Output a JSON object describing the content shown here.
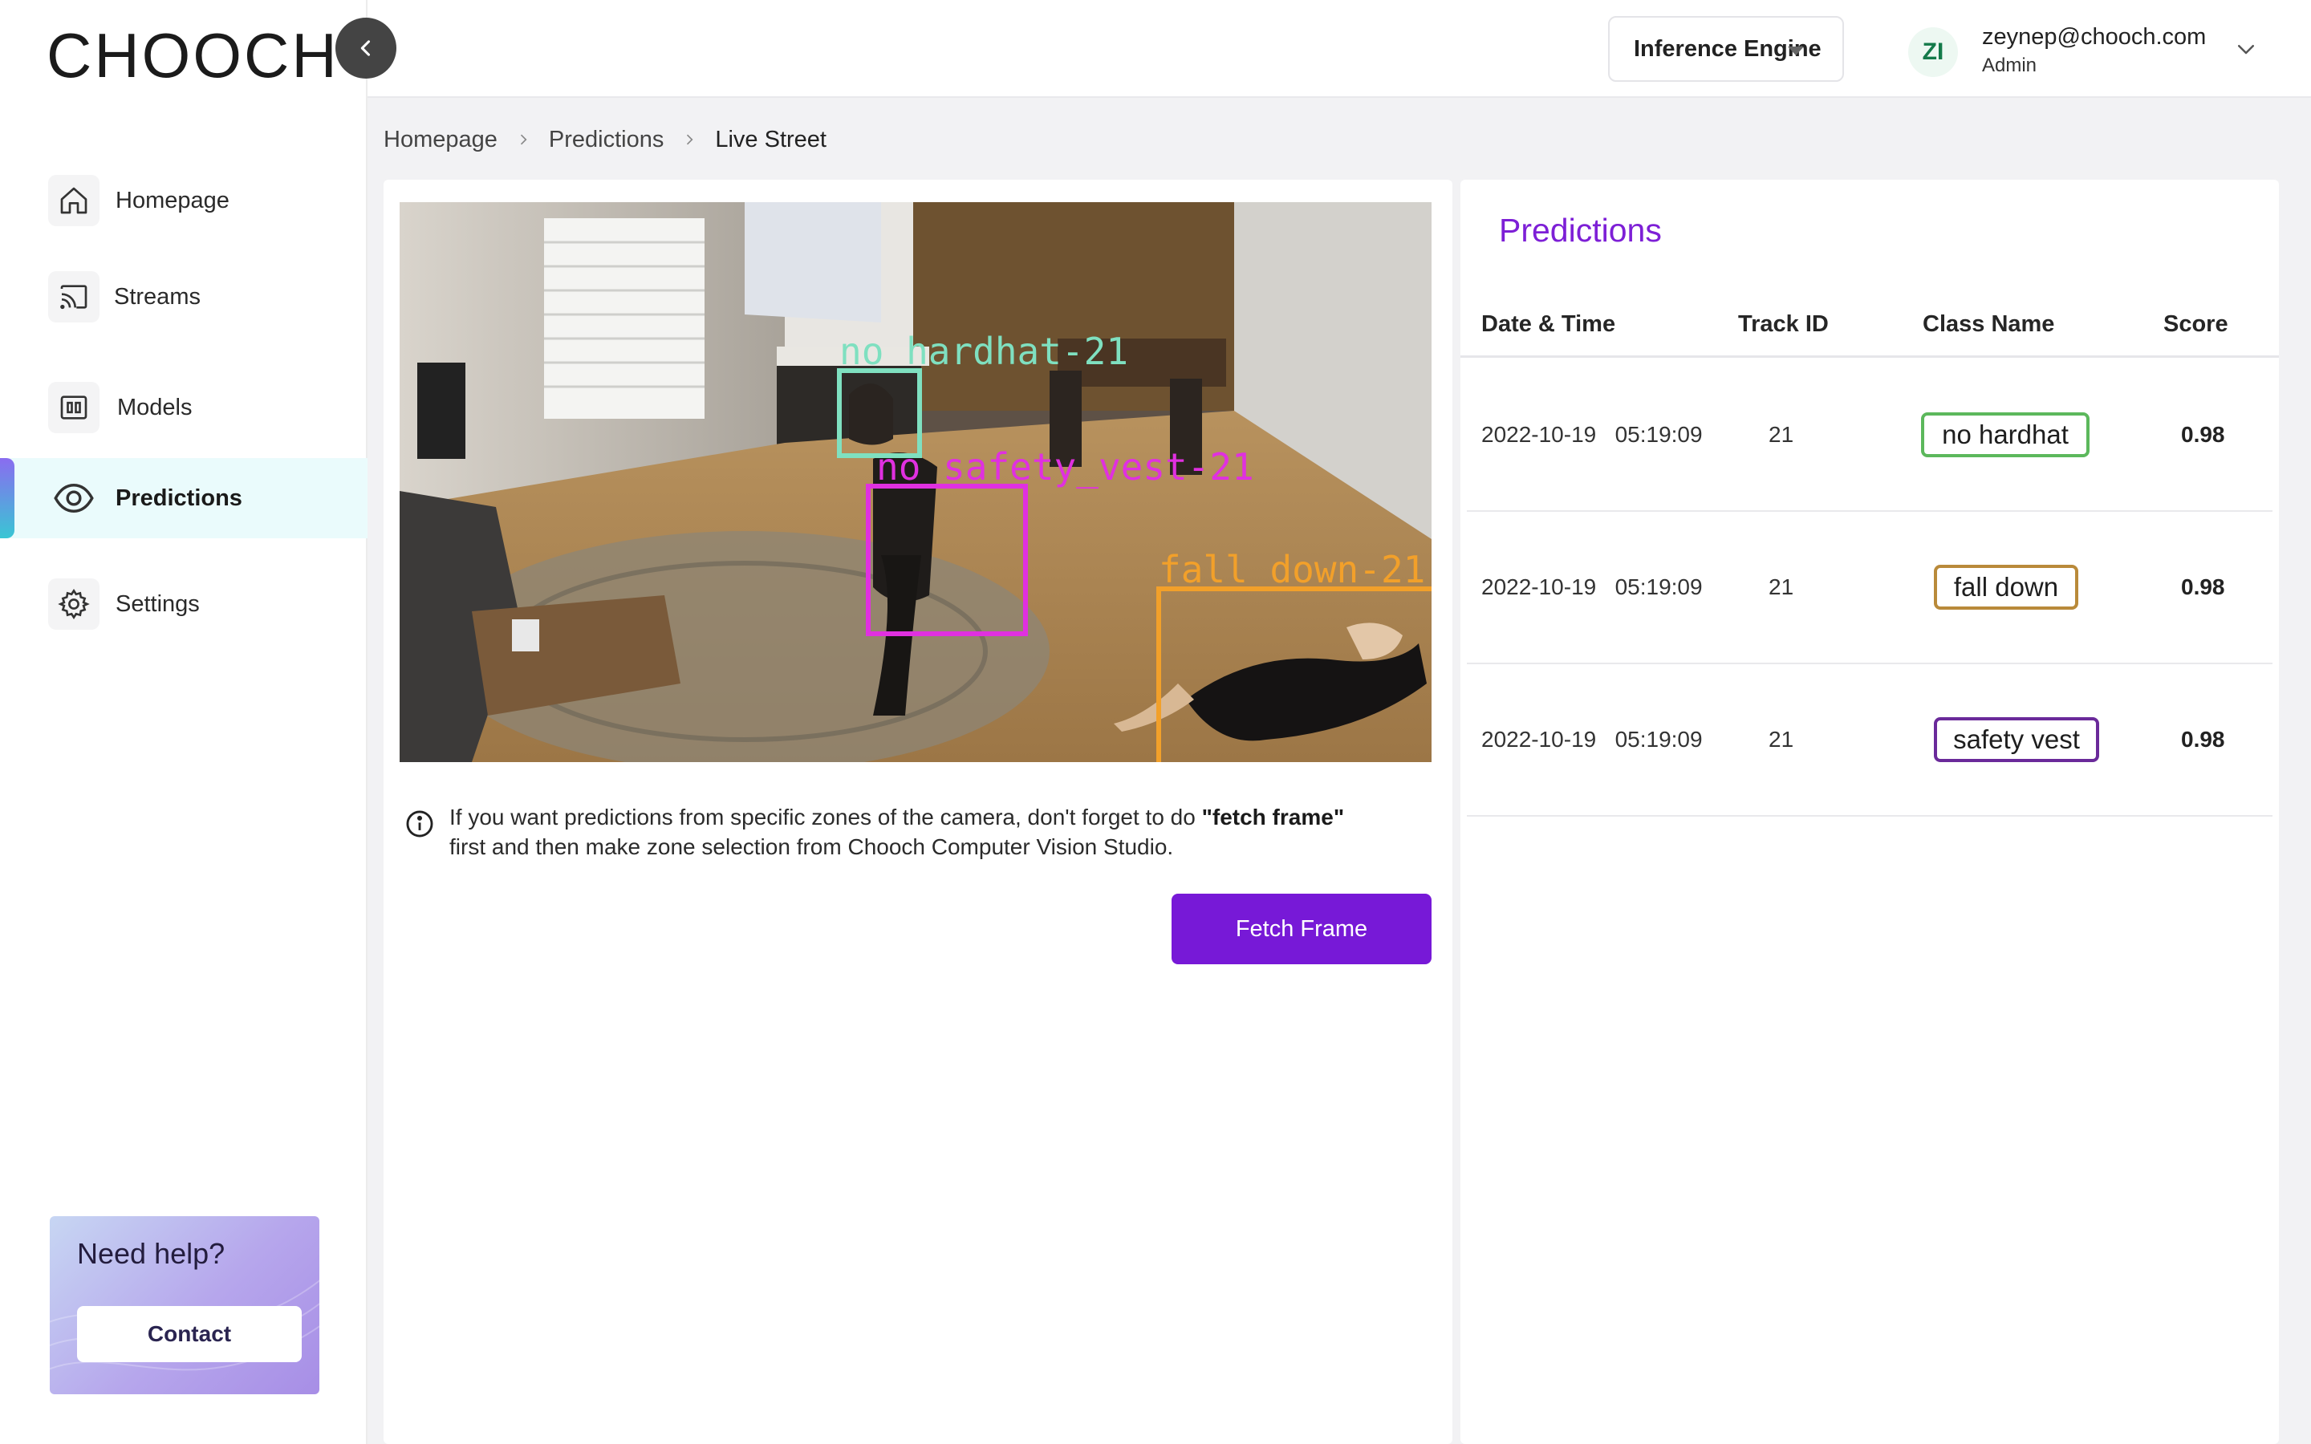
{
  "app": {
    "logo": "CHOOCH"
  },
  "sidebar": {
    "items": [
      {
        "label": "Homepage",
        "icon": "home-icon"
      },
      {
        "label": "Streams",
        "icon": "cast-icon"
      },
      {
        "label": "Models",
        "icon": "models-icon"
      },
      {
        "label": "Predictions",
        "icon": "eye-icon",
        "active": true
      },
      {
        "label": "Settings",
        "icon": "gear-icon"
      }
    ],
    "help": {
      "title": "Need help?",
      "button": "Contact"
    }
  },
  "topbar": {
    "engine": "Inference Engine",
    "user": {
      "initials": "ZI",
      "email": "zeynep@chooch.com",
      "role": "Admin"
    }
  },
  "breadcrumb": [
    "Homepage",
    "Predictions",
    "Live Street"
  ],
  "stream": {
    "detections": [
      {
        "label": "no_hardhat-21",
        "color": "#7fe0c0"
      },
      {
        "label": "no_safety_vest-21",
        "color": "#e030e0"
      },
      {
        "label": "fall_down-21",
        "color": "#f2a02a"
      }
    ],
    "info_text_1": "If you want predictions from specific zones of the camera, don't forget to do",
    "info_bold": "\"fetch frame\"",
    "info_text_2": "first and then make zone selection from Chooch Computer Vision Studio.",
    "fetch_button": "Fetch Frame"
  },
  "predictions": {
    "title": "Predictions",
    "columns": [
      "Date & Time",
      "Track ID",
      "Class Name",
      "Score"
    ],
    "rows": [
      {
        "date": "2022-10-19",
        "time": "05:19:09",
        "track_id": "21",
        "class_name": "no hardhat",
        "score": "0.98",
        "badge_color": "#5cb85c"
      },
      {
        "date": "2022-10-19",
        "time": "05:19:09",
        "track_id": "21",
        "class_name": "fall down",
        "score": "0.98",
        "badge_color": "#b98a3a"
      },
      {
        "date": "2022-10-19",
        "time": "05:19:09",
        "track_id": "21",
        "class_name": "safety vest",
        "score": "0.98",
        "badge_color": "#6a2a9a"
      }
    ]
  },
  "colors": {
    "accent": "#7719d7",
    "title": "#7d1fd6"
  }
}
